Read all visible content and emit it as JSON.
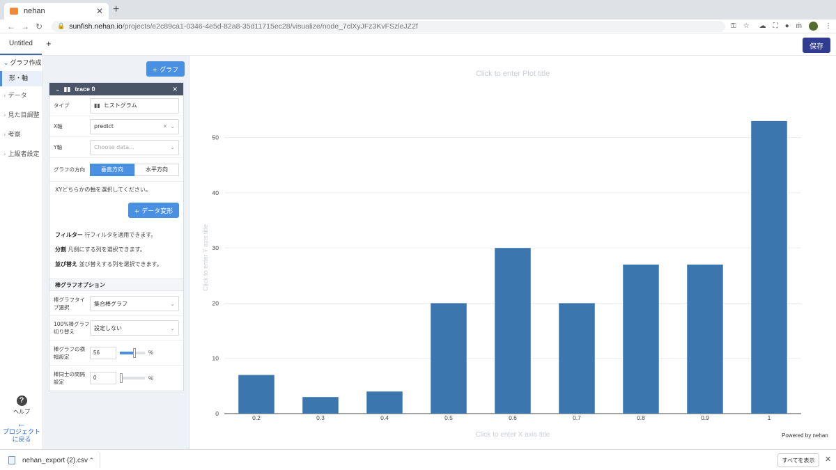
{
  "browser": {
    "tab_title": "nehan",
    "tab_close": "✕",
    "new_tab": "+",
    "url_host": "sunfish.nehan.io",
    "url_path": "/projects/e2c89ca1-0346-4e5d-82a8-35d11715ec28/visualize/node_7clXyJFz3KvFSzleJZ2f"
  },
  "header": {
    "tab_label": "Untitled",
    "add_tab": "+",
    "save_label": "保存"
  },
  "leftnav": {
    "section": "グラフ作成",
    "active": "形・軸",
    "items": [
      "データ",
      "見た目調整",
      "考察",
      "上級者設定"
    ],
    "help_label": "ヘルプ",
    "back_label": "プロジェクトに戻る"
  },
  "panel": {
    "add_graph": "+ グラフ",
    "trace_title": "trace 0",
    "type_label": "タイプ",
    "type_value": "ヒストグラム",
    "x_label": "X軸",
    "x_value": "predict",
    "y_label": "Y軸",
    "y_placeholder": "Choose data...",
    "dir_label": "グラフの方向",
    "dir_vertical": "垂直方向",
    "dir_horizontal": "水平方向",
    "xy_hint": "XYどちらかの軸を選択してください。",
    "data_transform": "+ データ変形",
    "filter_key": "フィルター",
    "filter_text": "行フィルタを適用できます。",
    "split_key": "分割",
    "split_text": "凡例にする列を選択できます。",
    "sort_key": "並び替え",
    "sort_text": "並び替えする列を選択できます。",
    "bar_options": "棒グラフオプション",
    "bar_type_label": "棒グラフタイプ選択",
    "bar_type_value": "集合棒グラフ",
    "pct_label": "100%棒グラフ切り替え",
    "pct_value": "設定しない",
    "width_label": "棒グラフの横幅設定",
    "width_value": "56",
    "gap_label": "棒同士の間隔設定",
    "gap_value": "0",
    "pct_unit": "%"
  },
  "chart": {
    "plot_title_placeholder": "Click to enter Plot title",
    "x_title_placeholder": "Click to enter X axis title",
    "y_title_placeholder": "Click to enter Y axis title",
    "powered_by": "Powered by nehan"
  },
  "chart_data": {
    "type": "bar",
    "categories": [
      "0.2",
      "0.3",
      "0.4",
      "0.5",
      "0.6",
      "0.7",
      "0.8",
      "0.9",
      "1"
    ],
    "values": [
      7,
      3,
      4,
      20,
      30,
      20,
      27,
      27,
      53
    ],
    "ylim": [
      0,
      55
    ],
    "yticks": [
      0,
      10,
      20,
      30,
      40,
      50
    ],
    "bar_color": "#3b76ae",
    "grid": true
  },
  "downloads": {
    "file_name": "nehan_export (2).csv",
    "show_all": "すべてを表示",
    "close": "✕"
  }
}
